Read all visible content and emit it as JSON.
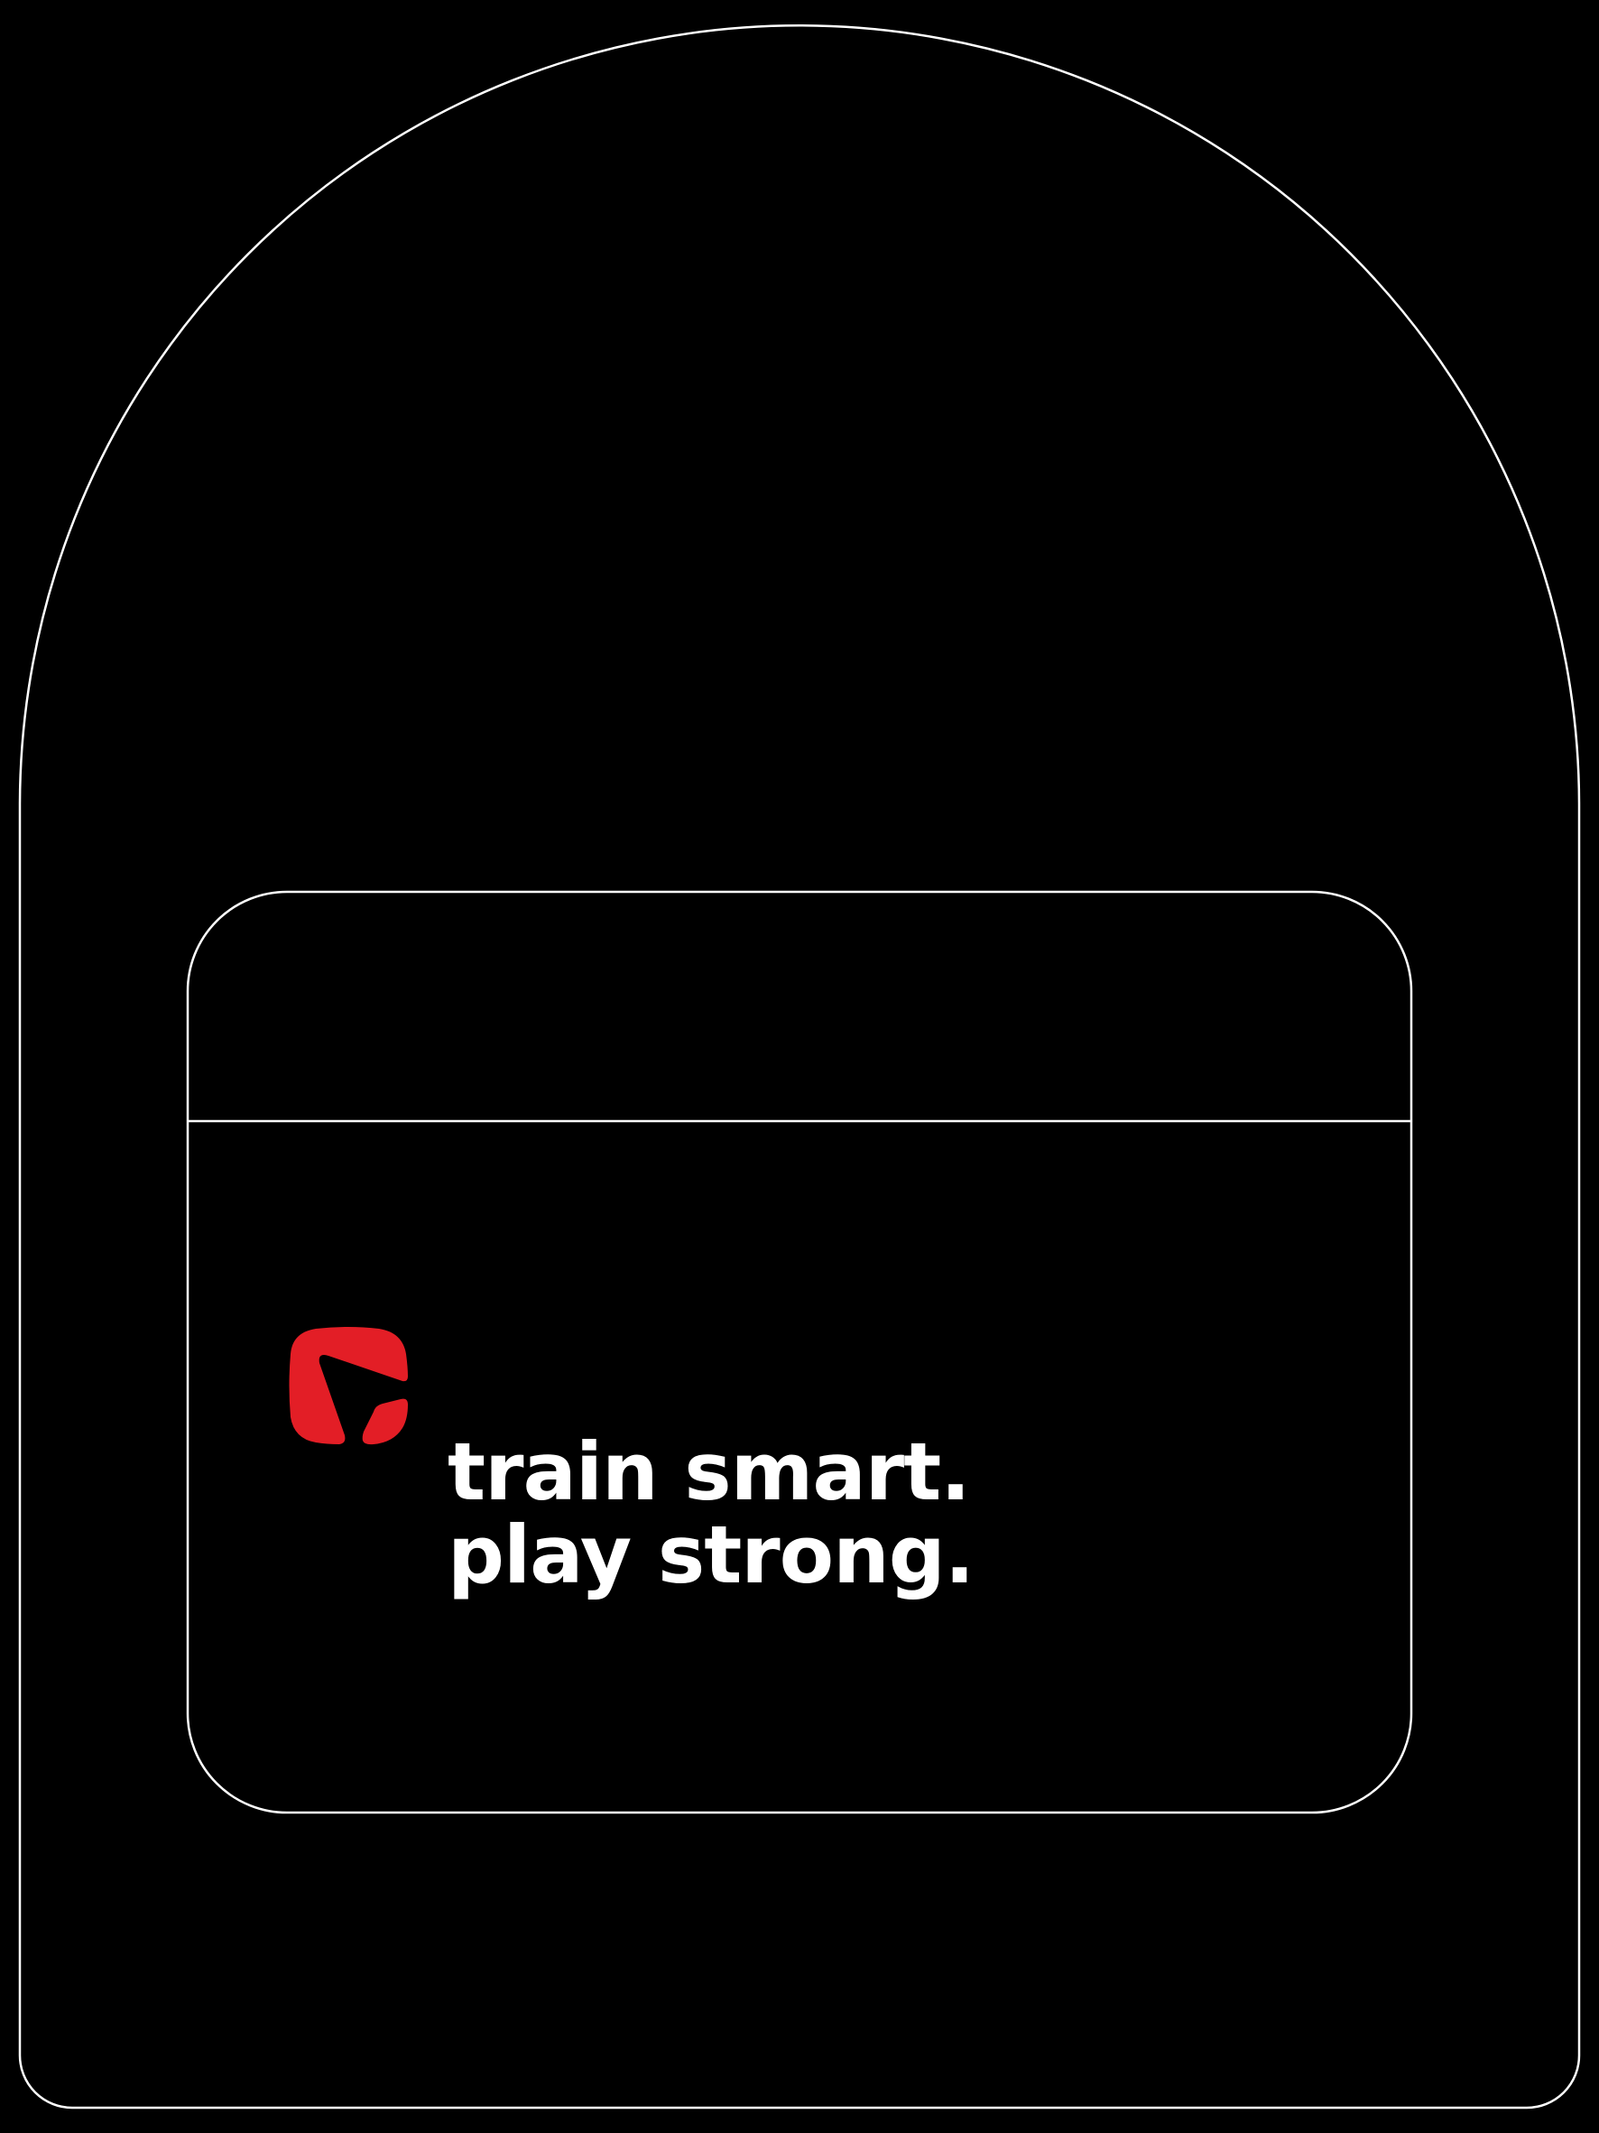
{
  "colors": {
    "background": "#000000",
    "outline": "#ffffff",
    "brand_accent": "#e31e26",
    "text": "#ffffff"
  },
  "logo": {
    "icon": "red-rounded-square-arrow-logo-icon"
  },
  "tagline": {
    "line1": "train smart.",
    "line2": "play strong."
  }
}
